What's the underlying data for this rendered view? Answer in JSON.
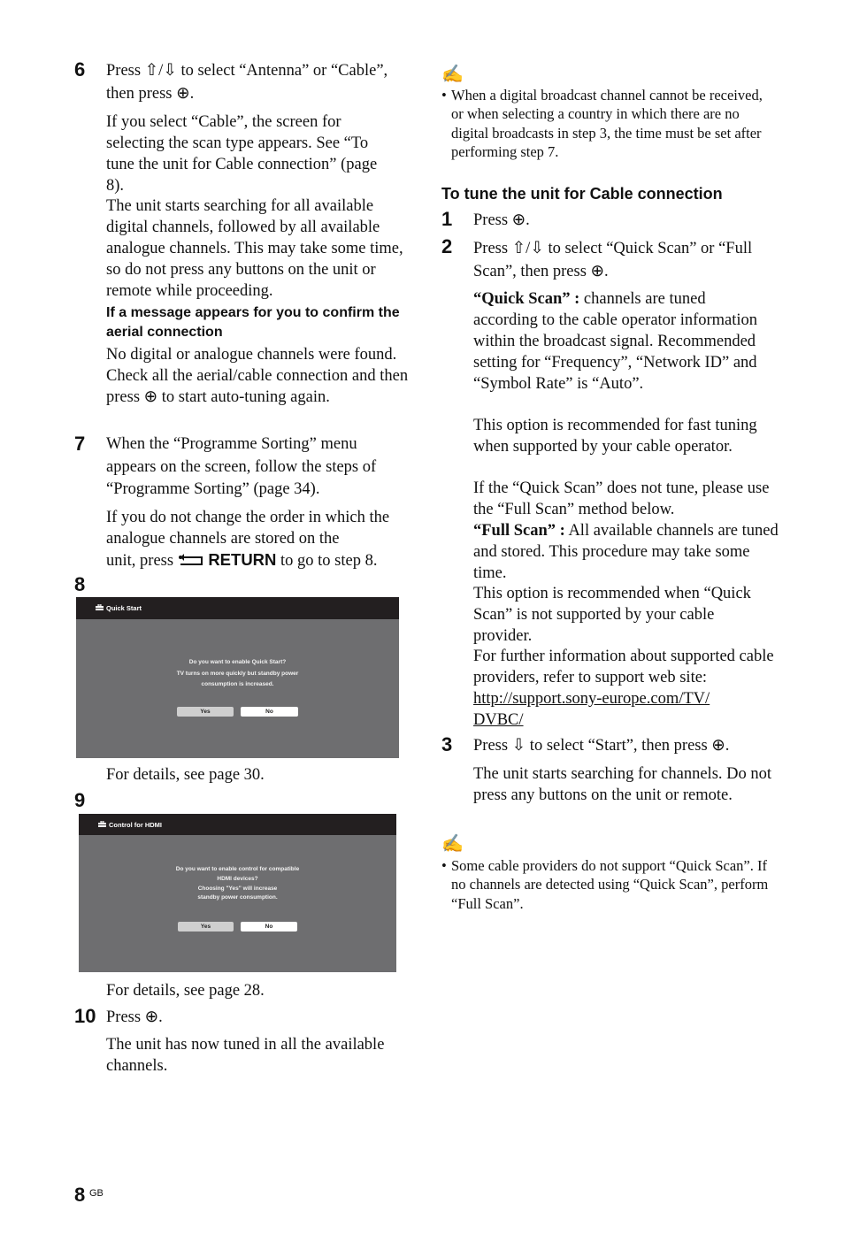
{
  "left": {
    "step6": {
      "num": "6",
      "line1": "Press ⇧/⇩ to select “Antenna” or “Cable”,",
      "line2": "then press ⊕.",
      "para1": "If you select “Cable”, the screen for selecting the scan type appears. See “To tune the unit for Cable connection” (page 8).",
      "para2": "The unit starts searching for all available digital channels, followed by all available analogue channels. This may take some time, so do not press any buttons on the unit or remote while proceeding.",
      "subheading": "If a message appears for you to confirm the aerial connection",
      "para3": "No digital or analogue channels were found. Check all the aerial/cable connection and then press ⊕ to start auto-tuning again."
    },
    "step7": {
      "num": "7",
      "text": "When the “Programme Sorting” menu appears on the screen, follow the steps of “Programme Sorting” (page 34).",
      "para_a": "If you do not change the order in which the analogue channels are stored on the",
      "para_b_pre": "unit, press",
      "return_icon": "return-icon",
      "return_label": "RETURN",
      "para_b_post": "to go to step 8."
    },
    "step8": {
      "num": "8",
      "screen": {
        "icon": "toolbox-icon",
        "title": "Quick Start",
        "lines": [
          "Do you want to enable Quick Start?",
          "TV turns on more quickly but standby power",
          "consumption is increased."
        ],
        "yes": "Yes",
        "no": "No"
      },
      "caption": "For details, see page 30."
    },
    "step9": {
      "num": "9",
      "screen": {
        "icon": "toolbox-icon",
        "title": "Control for HDMI",
        "lines": [
          "Do you want to enable control for compatible",
          "HDMI devices?",
          "Choosing \"Yes\" will increase",
          "standby power consumption."
        ],
        "yes": "Yes",
        "no": "No"
      },
      "caption": "For details, see page 28."
    },
    "step10": {
      "num": "10",
      "text": "Press ⊕.",
      "para": "The unit has now tuned in all the available channels."
    }
  },
  "right": {
    "note1": {
      "icon": "note-pencil-icon",
      "text": "When a digital broadcast channel cannot be received, or when selecting a country in which there are no digital broadcasts in step 3, the time must be set after performing step 7."
    },
    "heading": "To tune the unit for Cable connection",
    "step1": {
      "num": "1",
      "text": "Press ⊕."
    },
    "step2": {
      "num": "2",
      "text": "Press ⇧/⇩ to select “Quick Scan” or “Full Scan”, then press ⊕.",
      "quick_label": "“Quick Scan” :",
      "quick_text": "channels are tuned according to the cable operator information within the broadcast signal. Recommended setting for “Frequency”, “Network ID” and “Symbol Rate” is “Auto”.",
      "quick_rec": "This option is recommended for fast tuning when supported by your cable operator.",
      "quick_fail": "If the “Quick Scan” does not tune, please use the “Full Scan” method below.",
      "full_label": "“Full Scan” :",
      "full_text": "All available channels are tuned and stored. This procedure may take some time.",
      "full_rec": "This option is recommended when “Quick Scan” is not supported by your cable provider.",
      "further": "For further information about supported cable providers, refer to support web site:",
      "link": "http://support.sony-europe.com/TV/ DVBC/"
    },
    "step3": {
      "num": "3",
      "text": "Press ⇩ to select “Start”, then press ⊕.",
      "para": "The unit starts searching for channels. Do not press any buttons on the unit or remote."
    },
    "note2": {
      "icon": "note-pencil-icon",
      "text": "Some cable providers do not support “Quick Scan”. If no channels are detected using “Quick Scan”, perform “Full Scan”."
    }
  },
  "footer": {
    "page": "8",
    "suffix": "GB"
  }
}
